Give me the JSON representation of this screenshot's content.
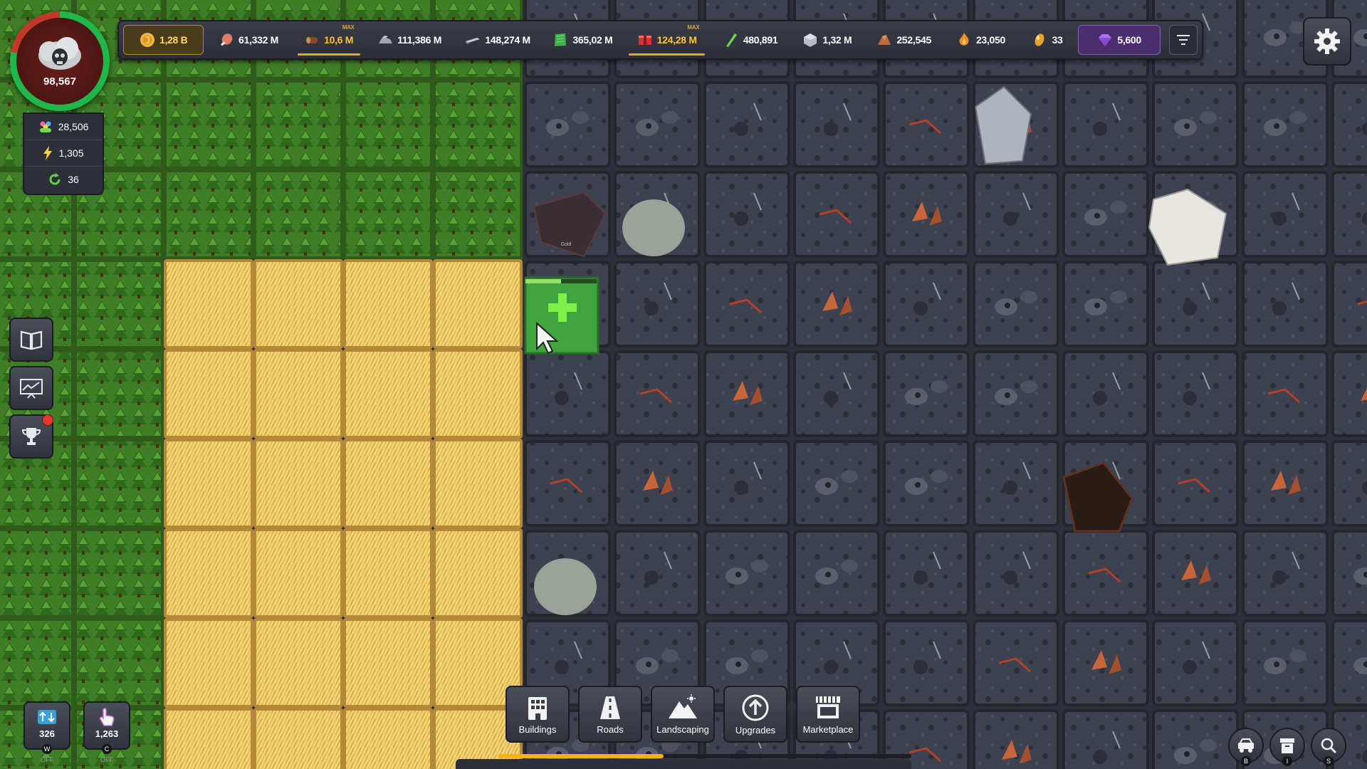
{
  "population": {
    "value": "98,567",
    "icon": "skull-cloud-icon"
  },
  "stats": [
    {
      "name": "workers",
      "icon": "people-icon",
      "value": "28,506"
    },
    {
      "name": "energy",
      "icon": "lightning-icon",
      "value": "1,305"
    },
    {
      "name": "cycle",
      "icon": "refresh-icon",
      "value": "36"
    }
  ],
  "resources": [
    {
      "id": "gold",
      "icon": "coin-icon",
      "value": "1,28 B",
      "color": "#f0b640"
    },
    {
      "id": "meat",
      "icon": "meat-icon",
      "value": "61,332 M",
      "color": "#e07a6a"
    },
    {
      "id": "wood",
      "icon": "log-icon",
      "value": "10,6 M",
      "color": "#8a4a2a",
      "max": "MAX"
    },
    {
      "id": "stone",
      "icon": "stone-pile-icon",
      "value": "111,386 M",
      "color": "#a0a6b0"
    },
    {
      "id": "iron",
      "icon": "iron-bar-icon",
      "value": "148,274 M",
      "color": "#c8ccd4"
    },
    {
      "id": "cloth",
      "icon": "cloth-icon",
      "value": "365,02 M",
      "color": "#3fb04a"
    },
    {
      "id": "tools",
      "icon": "crate-icon",
      "value": "124,28 M",
      "color": "#d8303a",
      "max": "MAX"
    },
    {
      "id": "crystal",
      "icon": "crystal-shard-icon",
      "value": "480,891",
      "color": "#6fd34a"
    },
    {
      "id": "silver",
      "icon": "silver-ore-icon",
      "value": "1,32 M",
      "color": "#c8ccd4"
    },
    {
      "id": "copper",
      "icon": "copper-ore-icon",
      "value": "252,545",
      "color": "#c06a3a"
    },
    {
      "id": "fire",
      "icon": "flame-leaf-icon",
      "value": "23,050",
      "color": "#f08a2a"
    },
    {
      "id": "relic",
      "icon": "golden-relic-icon",
      "value": "33",
      "color": "#e6a22a"
    },
    {
      "id": "gems",
      "icon": "gem-icon",
      "value": "5,600",
      "color": "#b070f0"
    }
  ],
  "side_buttons": [
    {
      "name": "codex",
      "icon": "book-icon"
    },
    {
      "name": "statistics",
      "icon": "chart-icon"
    },
    {
      "name": "achievements",
      "icon": "trophy-icon",
      "notification": true
    }
  ],
  "counters": [
    {
      "name": "workers-toggle",
      "icon": "transfer-icon",
      "value": "326",
      "key": "W",
      "state": "OFF"
    },
    {
      "name": "clicker-toggle",
      "icon": "hand-icon",
      "value": "1,263",
      "key": "C",
      "state": "OFF"
    }
  ],
  "toolbar": [
    {
      "name": "buildings",
      "label": "Buildings",
      "icon": "building-icon"
    },
    {
      "name": "roads",
      "label": "Roads",
      "icon": "road-icon"
    },
    {
      "name": "landscaping",
      "label": "Landscaping",
      "icon": "mountain-icon"
    },
    {
      "name": "upgrades",
      "label": "Upgrades",
      "icon": "upgrade-arrow-icon"
    },
    {
      "name": "marketplace",
      "label": "Marketplace",
      "icon": "market-stall-icon"
    }
  ],
  "progress": 0.4,
  "bottom_right": [
    {
      "name": "transport",
      "icon": "cart-icon",
      "key": "B"
    },
    {
      "name": "storage",
      "icon": "storage-icon",
      "key": "I"
    },
    {
      "name": "search",
      "icon": "search-icon",
      "key": "S"
    }
  ],
  "map": {
    "tile_label": "Gold",
    "colors": {
      "forest": "#3c7a26",
      "field": "#e9c055",
      "ground": "#3b3f4a",
      "lava": "#b3412a",
      "selection": "#3fa340"
    }
  }
}
